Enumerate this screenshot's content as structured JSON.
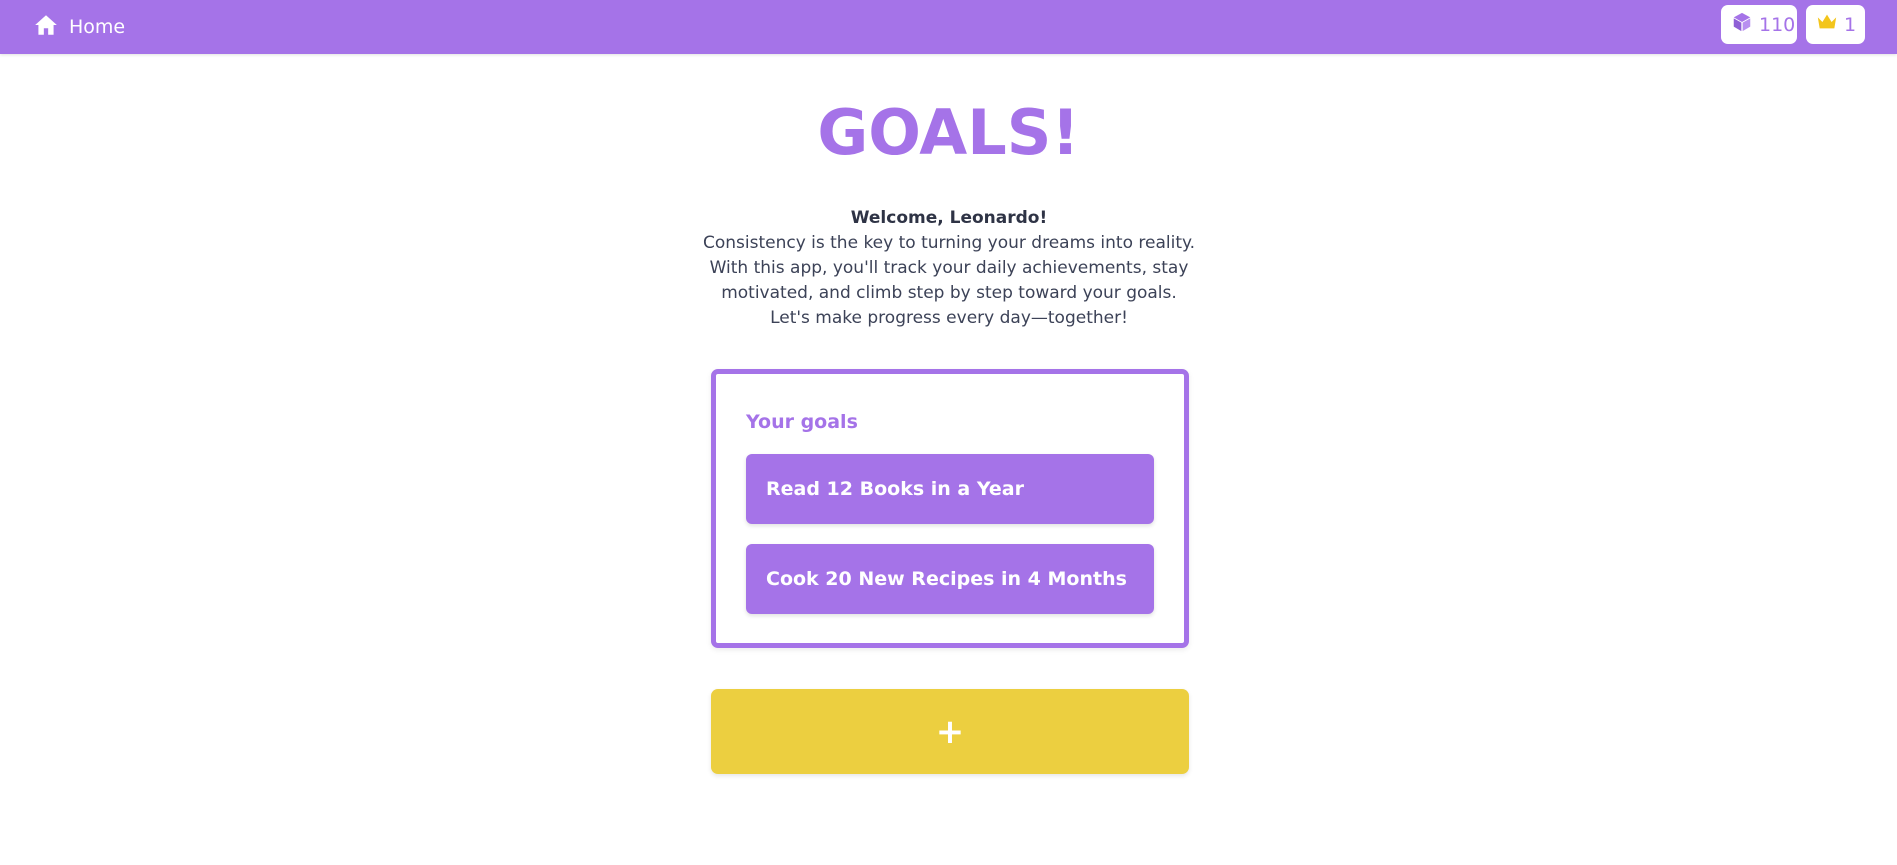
{
  "navbar": {
    "home_label": "Home",
    "cubes_count": "110",
    "crown_count": "1"
  },
  "main": {
    "title": "GOALS!",
    "welcome": "Welcome, Leonardo!",
    "intro_lines": [
      "Consistency is the key to turning your dreams into reality.",
      "With this app, you'll track your daily achievements, stay",
      "motivated, and climb step by step toward your goals.",
      "Let's make progress every day—together!"
    ]
  },
  "goals": {
    "heading": "Your goals",
    "items": [
      {
        "label": "Read 12 Books in a Year"
      },
      {
        "label": "Cook 20 New Recipes in 4 Months"
      }
    ]
  },
  "add_button": {
    "label": "+"
  },
  "colors": {
    "primary": "#a573e8",
    "accent": "#eccf40",
    "crown": "#f3c51b",
    "background": "#ffffff",
    "text": "#3c4257"
  },
  "icons": {
    "home": "home-icon",
    "cubes": "cube-icon",
    "crown": "crown-icon"
  }
}
